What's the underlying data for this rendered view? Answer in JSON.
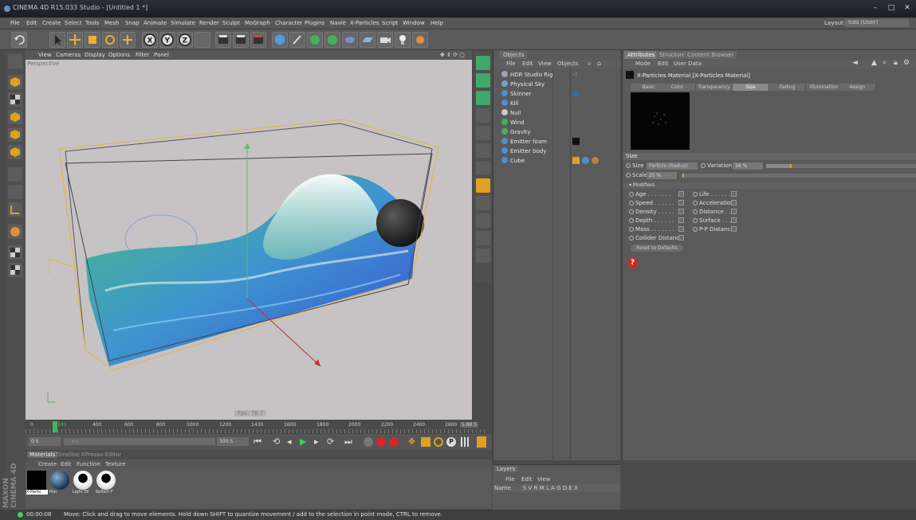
{
  "window": {
    "title": "CINEMA 4D R15.033 Studio - [Untitled 1 *]",
    "layout_label": "Layout:",
    "layout_value": "tuts (User)"
  },
  "menu": [
    "File",
    "Edit",
    "Create",
    "Select",
    "Tools",
    "Mesh",
    "Snap",
    "Animate",
    "Simulate",
    "Render",
    "Sculpt",
    "MoGraph",
    "Character",
    "Plugins",
    "Naviè",
    "X-Particles",
    "Script",
    "Window",
    "Help"
  ],
  "viewport": {
    "menu": [
      "View",
      "Cameras",
      "Display",
      "Options",
      "Filter",
      "Panel"
    ],
    "label": "Perspective",
    "fps": "Fps: 78.7"
  },
  "objects_panel": {
    "tab": "Objects",
    "menu": [
      "File",
      "Edit",
      "View",
      "Objects"
    ],
    "items": [
      {
        "name": "HDR Studio Rig",
        "color": "#9aa4b5"
      },
      {
        "name": "Physical Sky",
        "color": "#6fa3d8"
      },
      {
        "name": "Skinner",
        "color": "#4d8fd0"
      },
      {
        "name": "Kill",
        "color": "#4d8fd0"
      },
      {
        "name": "Null",
        "color": "#c8c8c8"
      },
      {
        "name": "Wind",
        "color": "#43b35a"
      },
      {
        "name": "Gravity",
        "color": "#43b35a"
      },
      {
        "name": "Emitter foam",
        "color": "#4d8fd0"
      },
      {
        "name": "Emitter body",
        "color": "#4d8fd0"
      },
      {
        "name": "Cube",
        "color": "#4d8fd0"
      }
    ]
  },
  "attributes": {
    "tabs": [
      "Attributes",
      "Structure",
      "Content Browser"
    ],
    "menu": [
      "Mode",
      "Edit",
      "User Data"
    ],
    "material_title": "X-Particles Material [X-Particles Material]",
    "subtabs": [
      "Basic",
      "Color",
      "Transparency",
      "Size",
      "Fading",
      "Illumination",
      "Assign"
    ],
    "active_subtab": "Size",
    "section": "Size",
    "size_label": "Size",
    "size_value": "Particle (Radius)",
    "variation_label": "Variation",
    "variation_value": "16 %",
    "scale_label": "Scale",
    "scale_value": "25 %",
    "modifiers_label": "Modifiers",
    "modifiers_left": [
      "Age",
      "Speed",
      "Density",
      "Depth",
      "Mass",
      "Collider Distance"
    ],
    "modifiers_right": [
      "Life",
      "Acceleration",
      "Distance",
      "Surface",
      "P-P Distance"
    ],
    "reset_button": "Reset to Defaults"
  },
  "timeline": {
    "ticks": [
      "0",
      "143",
      "400",
      "600",
      "800",
      "1000",
      "1200",
      "1430",
      "1600",
      "1800",
      "2000",
      "2200",
      "2400",
      "2600"
    ],
    "end_value": "5.88 S",
    "current_frame": "0 S",
    "field2": "0 S",
    "end_field": "300 S"
  },
  "materials": {
    "tabs": [
      "Materials",
      "Timeline",
      "XPresso Editor"
    ],
    "menu": [
      "Create",
      "Edit",
      "Function",
      "Texture"
    ],
    "items": [
      {
        "label": "X-Partic"
      },
      {
        "label": "Mat"
      },
      {
        "label": "Light 58"
      },
      {
        "label": "Reflect F"
      }
    ]
  },
  "layers": {
    "tab": "Layers",
    "menu": [
      "File",
      "Edit",
      "View"
    ],
    "name_col": "Name",
    "columns": "S V R M L A G D E X"
  },
  "status": {
    "time": "00:00:08",
    "message": "Move: Click and drag to move elements. Hold down SHIFT to quantize movement / add to the selection in point mode, CTRL to remove."
  },
  "branding": "MAXON CINEMA 4D",
  "colors": {
    "accent_orange": "#e0a020",
    "particle_green": "#3bbf7a",
    "particle_blue": "#2a4fd6"
  }
}
